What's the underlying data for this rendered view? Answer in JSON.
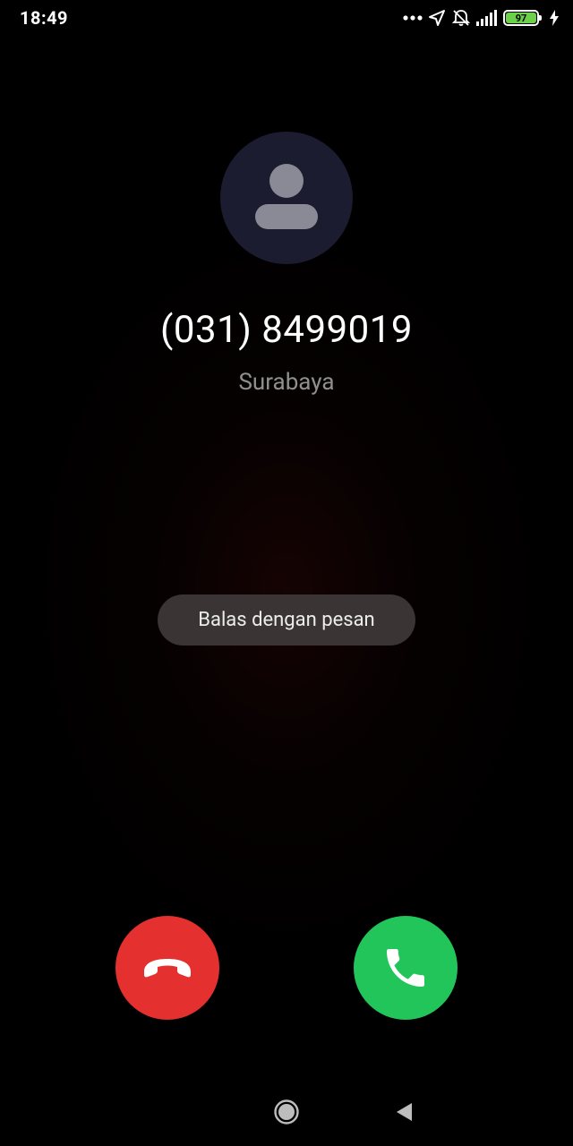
{
  "status_bar": {
    "time": "18:49",
    "battery_level": "97",
    "icons": [
      "more-dots-icon",
      "location-arrow-icon",
      "bell-off-icon",
      "signal-icon",
      "battery-icon",
      "charging-bolt-icon"
    ]
  },
  "caller": {
    "number": "(031) 8499019",
    "location": "Surabaya",
    "avatar_icon": "person-icon"
  },
  "actions": {
    "reply_label": "Balas dengan pesan",
    "decline_icon": "phone-hangup-icon",
    "accept_icon": "phone-answer-icon"
  },
  "nav_bar": {
    "home_icon": "home-circle-icon",
    "back_icon": "back-triangle-icon"
  },
  "colors": {
    "decline": "#e4302f",
    "accept": "#22c55a",
    "avatar_bg": "#1c1c30",
    "battery": "#6cd14a"
  }
}
